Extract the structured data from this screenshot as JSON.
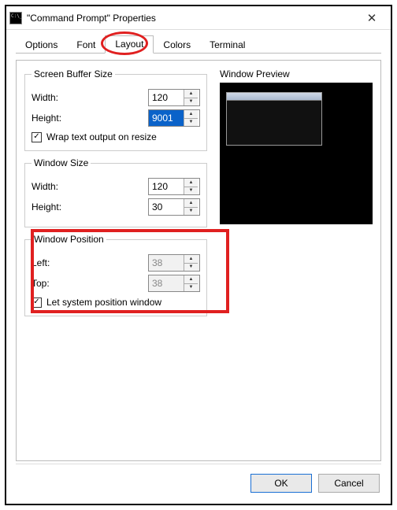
{
  "window": {
    "title": "\"Command Prompt\" Properties",
    "close_label": "✕"
  },
  "tabs": {
    "options": "Options",
    "font": "Font",
    "layout": "Layout",
    "colors": "Colors",
    "terminal": "Terminal"
  },
  "screen_buffer": {
    "legend": "Screen Buffer Size",
    "width_label": "Width:",
    "width_value": "120",
    "height_label": "Height:",
    "height_value": "9001",
    "wrap_label": "Wrap text output on resize",
    "wrap_checked": "✓"
  },
  "window_size": {
    "legend": "Window Size",
    "width_label": "Width:",
    "width_value": "120",
    "height_label": "Height:",
    "height_value": "30"
  },
  "window_position": {
    "legend": "Window Position",
    "left_label": "Left:",
    "left_value": "38",
    "top_label": "Top:",
    "top_value": "38",
    "auto_label": "Let system position window",
    "auto_checked": "✓"
  },
  "preview": {
    "label": "Window Preview"
  },
  "buttons": {
    "ok": "OK",
    "cancel": "Cancel"
  },
  "glyphs": {
    "up": "▲",
    "down": "▼"
  }
}
